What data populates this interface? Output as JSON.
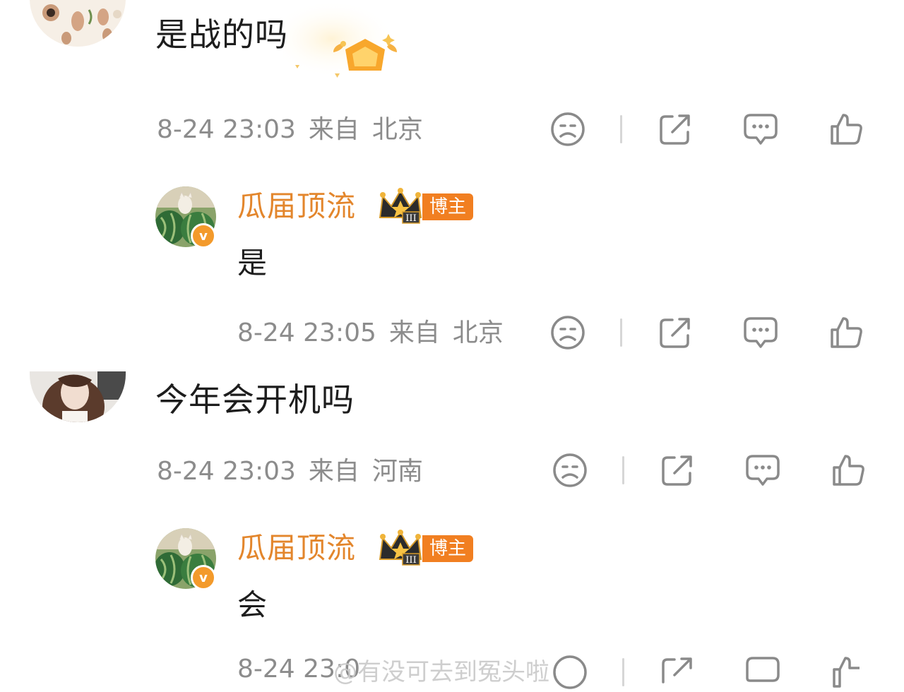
{
  "comments": [
    {
      "text": "是战的吗",
      "time": "8-24 23:03",
      "from": "来自",
      "location": "北京",
      "reply": {
        "author": "瓜届顶流",
        "badge": "博主",
        "text": "是",
        "time": "8-24 23:05",
        "from": "来自",
        "location": "北京"
      }
    },
    {
      "text": "今年会开机吗",
      "time": "8-24 23:03",
      "from": "来自",
      "location": "河南",
      "reply": {
        "author": "瓜届顶流",
        "badge": "博主",
        "text": "会",
        "time": "8-24 23:0",
        "from": "",
        "location": ""
      }
    }
  ],
  "icons": [
    "dislike-icon",
    "share-icon",
    "comment-icon",
    "like-icon"
  ],
  "watermark": "@有没可去到冤头啦",
  "colors": {
    "author": "#e3862c",
    "badge": "#f17f21",
    "meta": "#8c8c8c",
    "icon": "#8a8a8a"
  }
}
